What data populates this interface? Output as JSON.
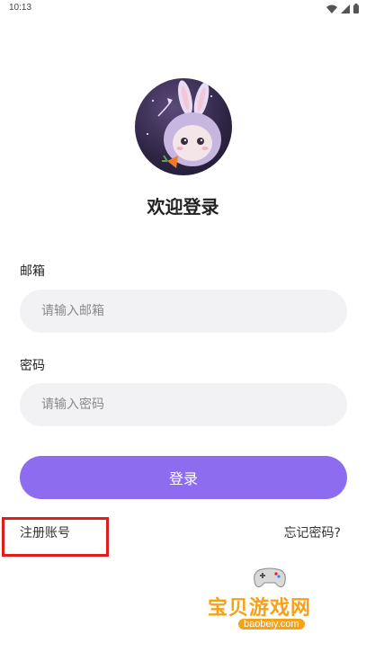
{
  "status_bar": {
    "time": "10:13"
  },
  "page": {
    "title": "欢迎登录"
  },
  "email": {
    "label": "邮箱",
    "placeholder": "请输入邮箱",
    "value": ""
  },
  "password": {
    "label": "密码",
    "placeholder": "请输入密码",
    "value": ""
  },
  "actions": {
    "login_label": "登录",
    "register_label": "注册账号",
    "forgot_label": "忘记密码?"
  },
  "watermark": {
    "brand": "宝贝游戏网",
    "url": "baobeiy.com"
  },
  "colors": {
    "accent": "#8d6cf0",
    "input_bg": "#f2f2f4",
    "highlight": "#e11c1c",
    "watermark": "#f6a11a"
  }
}
